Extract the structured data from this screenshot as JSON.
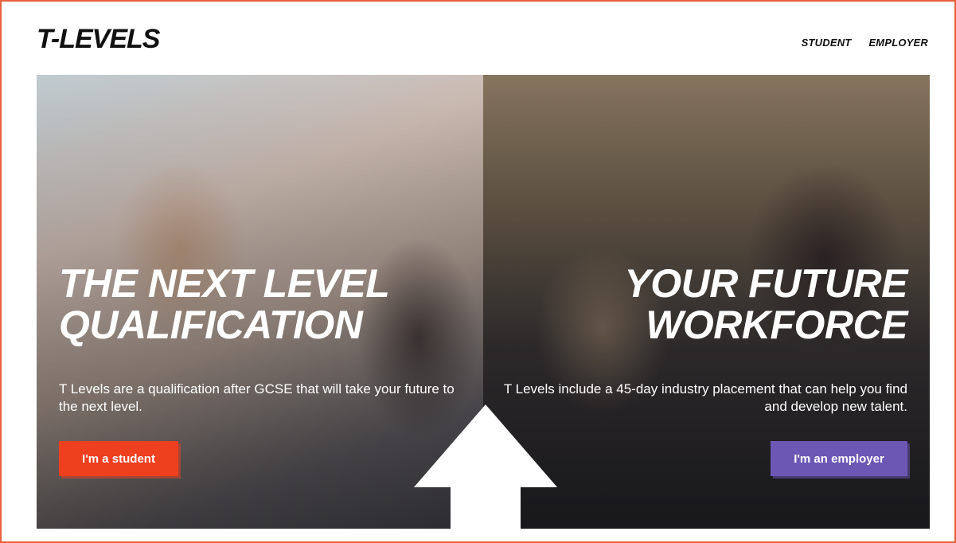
{
  "header": {
    "logo": "T-LEVELS",
    "nav": [
      {
        "label": "STUDENT"
      },
      {
        "label": "EMPLOYER"
      }
    ]
  },
  "student_panel": {
    "headline": [
      "THE NEXT LEVEL",
      "QUALIFICATION"
    ],
    "description": "T Levels are a qualification after GCSE that will take your future to the next level.",
    "button_label": "I'm a student"
  },
  "employer_panel": {
    "headline": [
      "YOUR FUTURE",
      "WORKFORCE"
    ],
    "description": "T Levels include a 45-day industry placement that can help you find and develop new talent.",
    "button_label": "I'm an employer"
  },
  "colors": {
    "frame": "#e8603c",
    "student_button": "#ee3f1f",
    "employer_button": "#6b58b5"
  },
  "icons": {
    "center_arrow": "up-arrow-icon"
  }
}
